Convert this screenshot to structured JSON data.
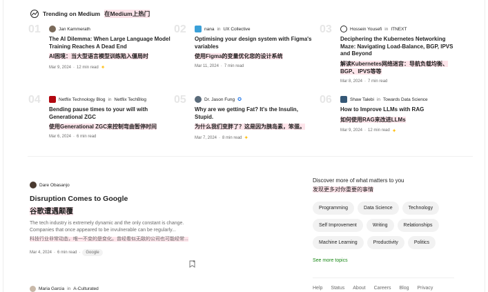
{
  "trending": {
    "heading": "Trending on Medium",
    "heading_zh": "在Medium上热门",
    "items": [
      {
        "num": "01",
        "author": "Jan Kammerath",
        "title": "The AI Dilemma: When Large Language Model Training Reaches A Dead End",
        "title_zh": "AI困境：当大型语言模型训练陷入僵局时",
        "date": "Mar 9, 2024",
        "read": "12 min read",
        "starred": true
      },
      {
        "num": "02",
        "author": "nana",
        "pub_in": "in",
        "publication": "UX Collective",
        "title": "Optimising your design system with Figma's variables",
        "title_zh": "使用Figma的变量优化您的设计系统",
        "date": "Mar 11, 2024",
        "read": "7 min read",
        "starred": false
      },
      {
        "num": "03",
        "author": "Hossein Yousefi",
        "pub_in": "in",
        "publication": "ITNEXT",
        "title": "Deciphering the Kubernetes Networking Maze: Navigating Load-Balance, BGP, IPVS and Beyond",
        "title_zh": "解读Kubernetes网络迷宫：导航负载均衡、BGP、IPVS等等",
        "date": "Mar 8, 2024",
        "read": "7 min read",
        "starred": false
      },
      {
        "num": "04",
        "author": "Netflix Technology Blog",
        "pub_in": "in",
        "publication": "Netflix TechBlog",
        "title": "Bending pause times to your will with Generational ZGC",
        "title_zh": "使用Generational ZGC来控制弯曲暂停时间",
        "date": "Mar 6, 2024",
        "read": "6 min read",
        "starred": false
      },
      {
        "num": "05",
        "author": "Dr. Jason Fung",
        "title": "Why are we getting Fat? It's the Insulin, Stupid.",
        "title_zh": "为什么我们变胖了？这是因为胰岛素，笨蛋。",
        "date": "Mar 7, 2024",
        "read": "8 min read",
        "starred": true
      },
      {
        "num": "06",
        "author": "Shaw Talebi",
        "pub_in": "in",
        "publication": "Towards Data Science",
        "title": "How to Improve LLMs with RAG",
        "title_zh": "如何使用RAG来改进LLMs",
        "date": "Mar 9, 2024",
        "read": "12 min read",
        "starred": true
      }
    ]
  },
  "article": {
    "author": "Dare Obasanjo",
    "title": "Disruption Comes to Google",
    "title_zh": "谷歌遭遇颠覆",
    "body": "The tech industry is extremely dynamic and the only constant is change. Companies that once appeared to be invulnerable can be regularly...",
    "body_zh": "科技行业非常动态，唯一不变的是变化。曾经看似无敌的公司也可能经常...",
    "date": "Mar 4, 2024",
    "read": "6 min read",
    "tag": "Google"
  },
  "discover": {
    "title": "Discover more of what matters to you",
    "title_zh": "发现更多对你重要的事情",
    "topics": [
      "Programming",
      "Data Science",
      "Technology",
      "Self Improvement",
      "Writing",
      "Relationships",
      "Machine Learning",
      "Productivity",
      "Politics"
    ],
    "see_more": "See more topics"
  },
  "next_article": {
    "author": "Maria Garcia",
    "pub_in": "in",
    "publication": "A-Culturated"
  },
  "footer": [
    "Help",
    "Status",
    "About",
    "Careers",
    "Blog",
    "Privacy"
  ],
  "colors": {
    "accent_green": "#1a8917",
    "star": "#ffc017",
    "highlight": "#fde4ea"
  },
  "icons": {
    "trending": "trending-icon",
    "star": "star-icon",
    "bookmark": "bookmark-icon"
  }
}
